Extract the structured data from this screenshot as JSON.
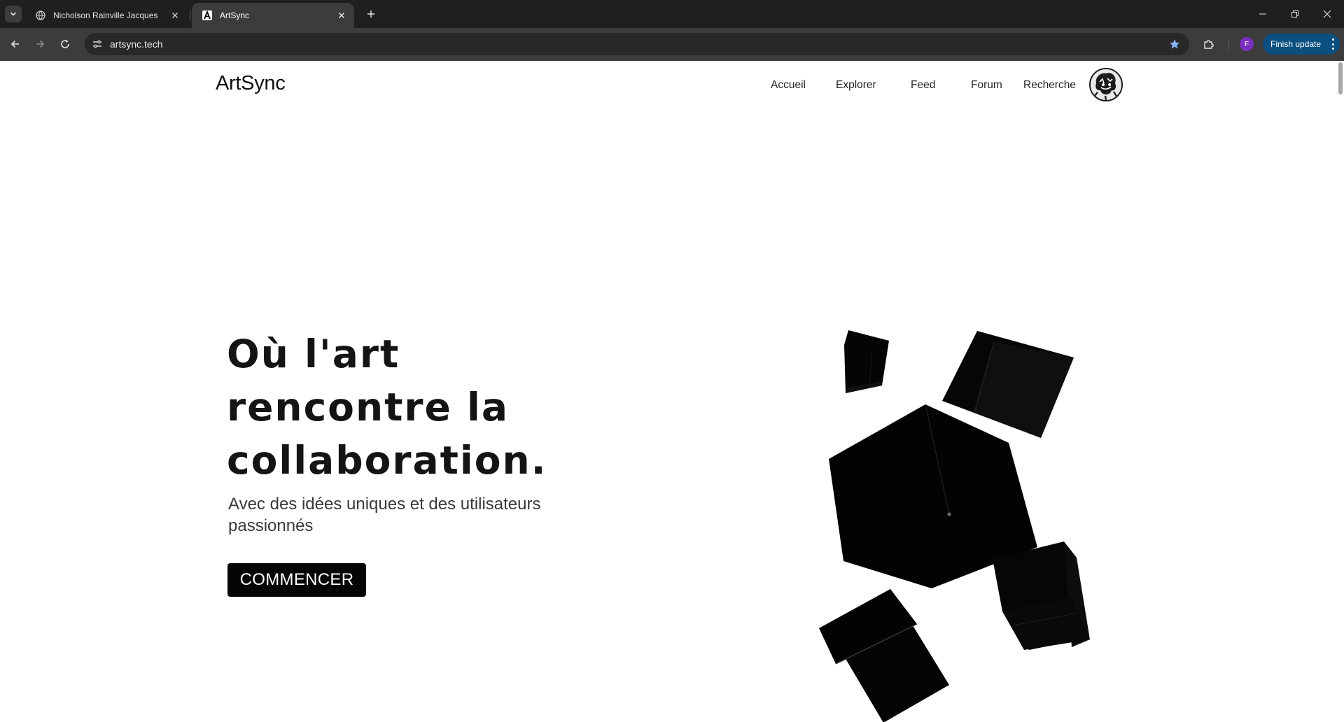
{
  "browser": {
    "tabs": [
      {
        "title": "Nicholson Rainville Jacques",
        "active": false,
        "icon": "globe-icon"
      },
      {
        "title": "ArtSync",
        "active": true,
        "icon": "artsync-logo-icon"
      }
    ],
    "url": "artsync.tech",
    "profile_initial": "F",
    "update_button": "Finish update",
    "colors": {
      "tabbar": "#1f1f1f",
      "toolbar": "#3c3c3c",
      "update_button": "#0b4f80",
      "profile": "#7b2fbe"
    }
  },
  "site": {
    "brand": "ArtSync",
    "nav": [
      "Accueil",
      "Explorer",
      "Feed",
      "Forum",
      "Recherche"
    ],
    "hero": {
      "title_lines": [
        "Où l'art",
        "rencontre la",
        "collaboration."
      ],
      "subtitle": "Avec des idées uniques et des utilisateurs passionnés",
      "cta": "COMMENCER"
    }
  }
}
